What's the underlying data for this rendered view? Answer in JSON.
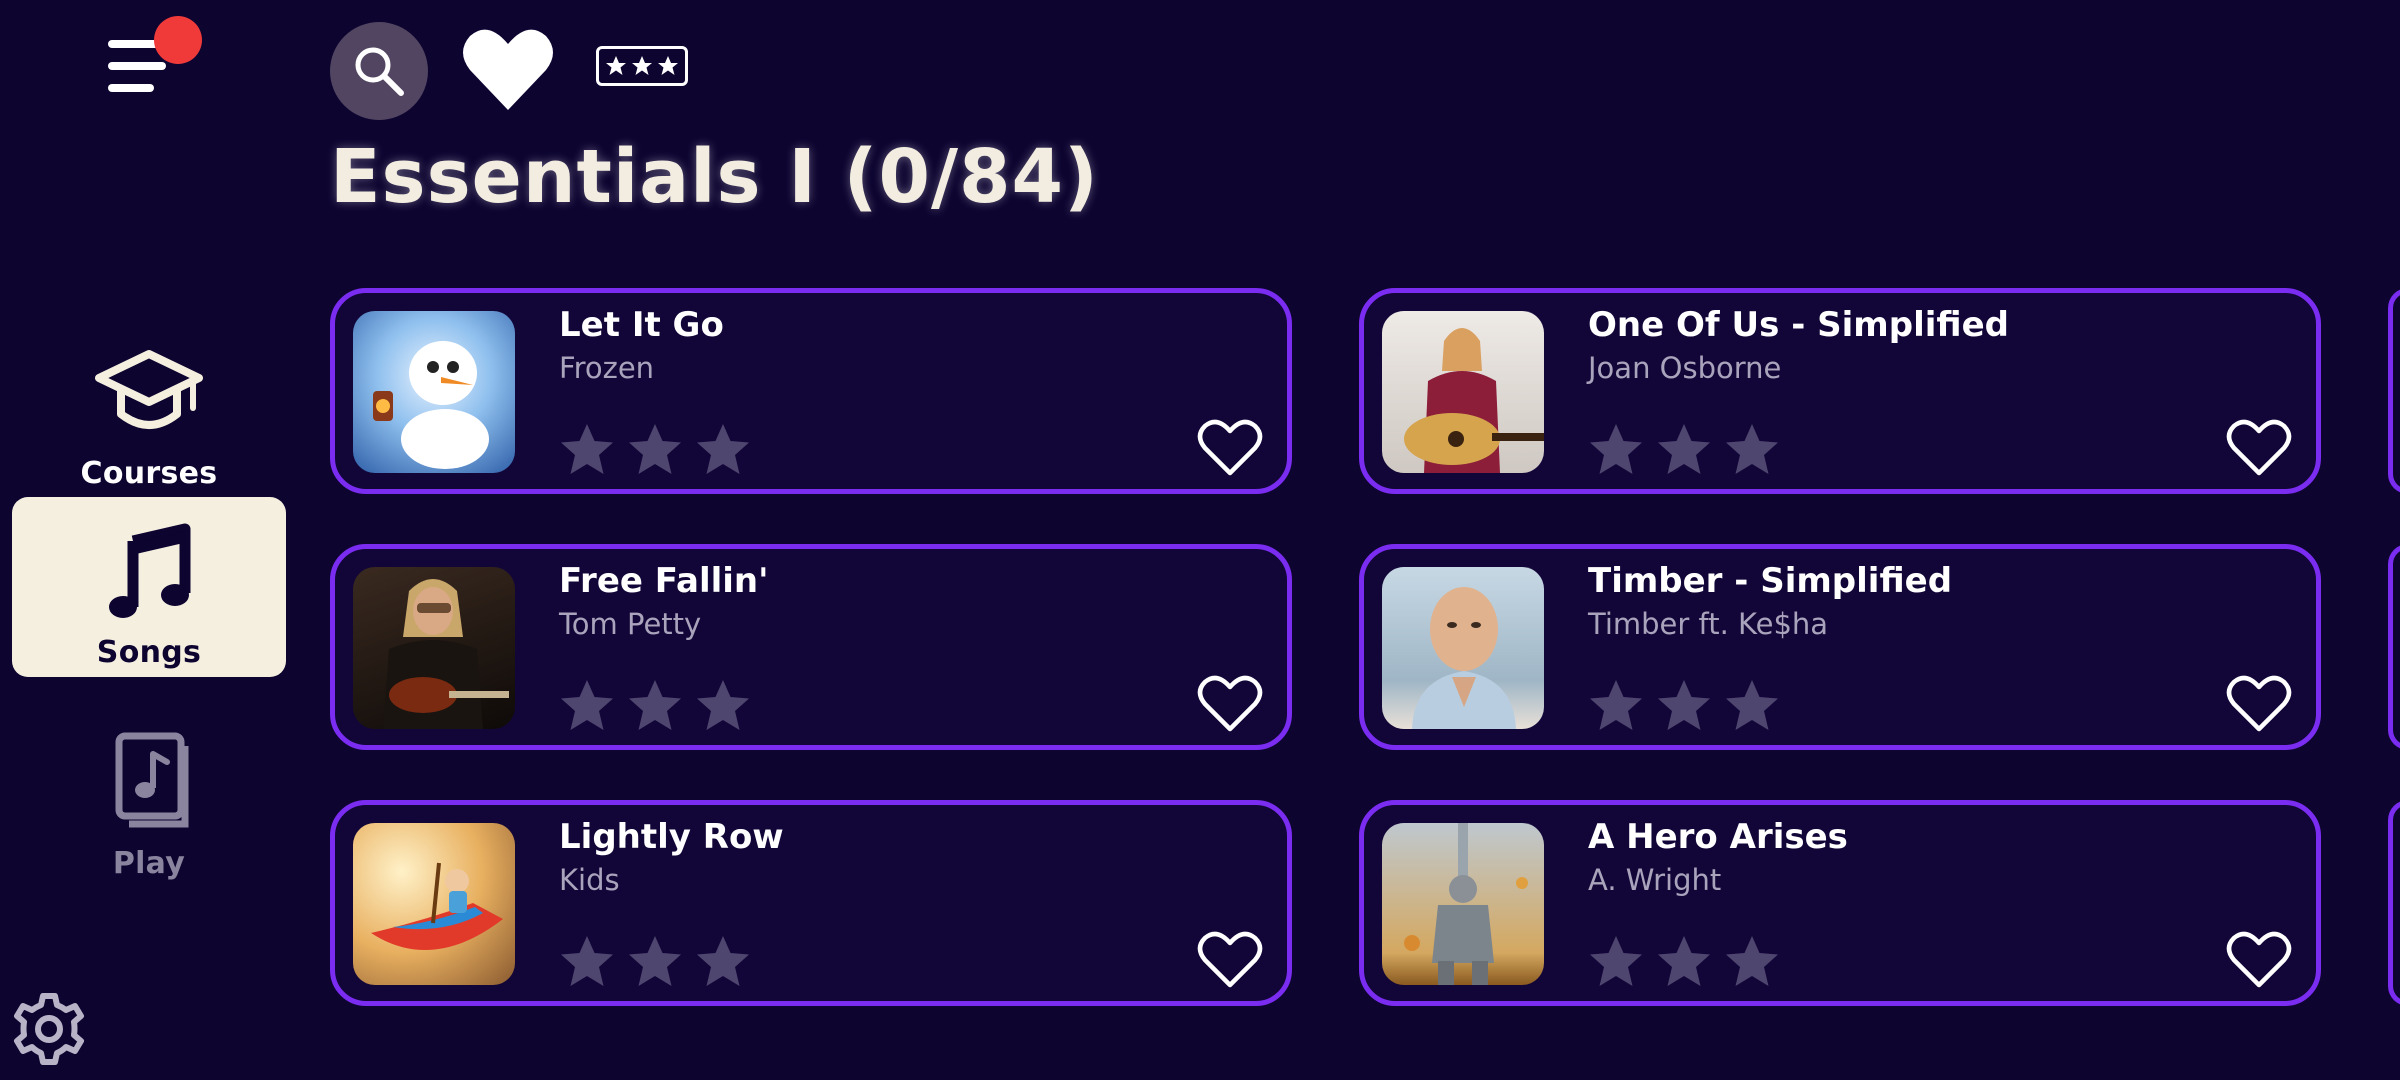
{
  "colors": {
    "background": "#0d0430",
    "card_border": "#7a2cf0",
    "notification_dot": "#f03a3a",
    "selected_nav_bg": "#f5efe0",
    "star_empty": "#4f4670"
  },
  "header": {
    "title": "Essentials I (0/84)",
    "search_icon": "search-icon",
    "favorites_icon": "heart-icon",
    "difficulty_icon": "stars-filter-icon"
  },
  "sidebar": {
    "menu_icon": "menu-icon",
    "has_notification": true,
    "items": [
      {
        "label": "Courses",
        "icon": "graduation-cap-icon",
        "selected": false
      },
      {
        "label": "Songs",
        "icon": "music-note-icon",
        "selected": true
      },
      {
        "label": "Play",
        "icon": "sheet-music-icon",
        "selected": false,
        "disabled": true
      }
    ],
    "settings_icon": "gear-icon"
  },
  "songs": [
    {
      "title": "Let It Go",
      "artist": "Frozen",
      "stars_earned": 0,
      "stars_total": 3,
      "favorite": false
    },
    {
      "title": "One Of Us - Simplified",
      "artist": "Joan Osborne",
      "stars_earned": 0,
      "stars_total": 3,
      "favorite": false
    },
    {
      "title": "Free Fallin'",
      "artist": "Tom Petty",
      "stars_earned": 0,
      "stars_total": 3,
      "favorite": false
    },
    {
      "title": "Timber - Simplified",
      "artist": "Timber ft. Ke$ha",
      "stars_earned": 0,
      "stars_total": 3,
      "favorite": false
    },
    {
      "title": "Lightly Row",
      "artist": "Kids",
      "stars_earned": 0,
      "stars_total": 3,
      "favorite": false
    },
    {
      "title": "A Hero Arises",
      "artist": "A. Wright",
      "stars_earned": 0,
      "stars_total": 3,
      "favorite": false
    }
  ]
}
